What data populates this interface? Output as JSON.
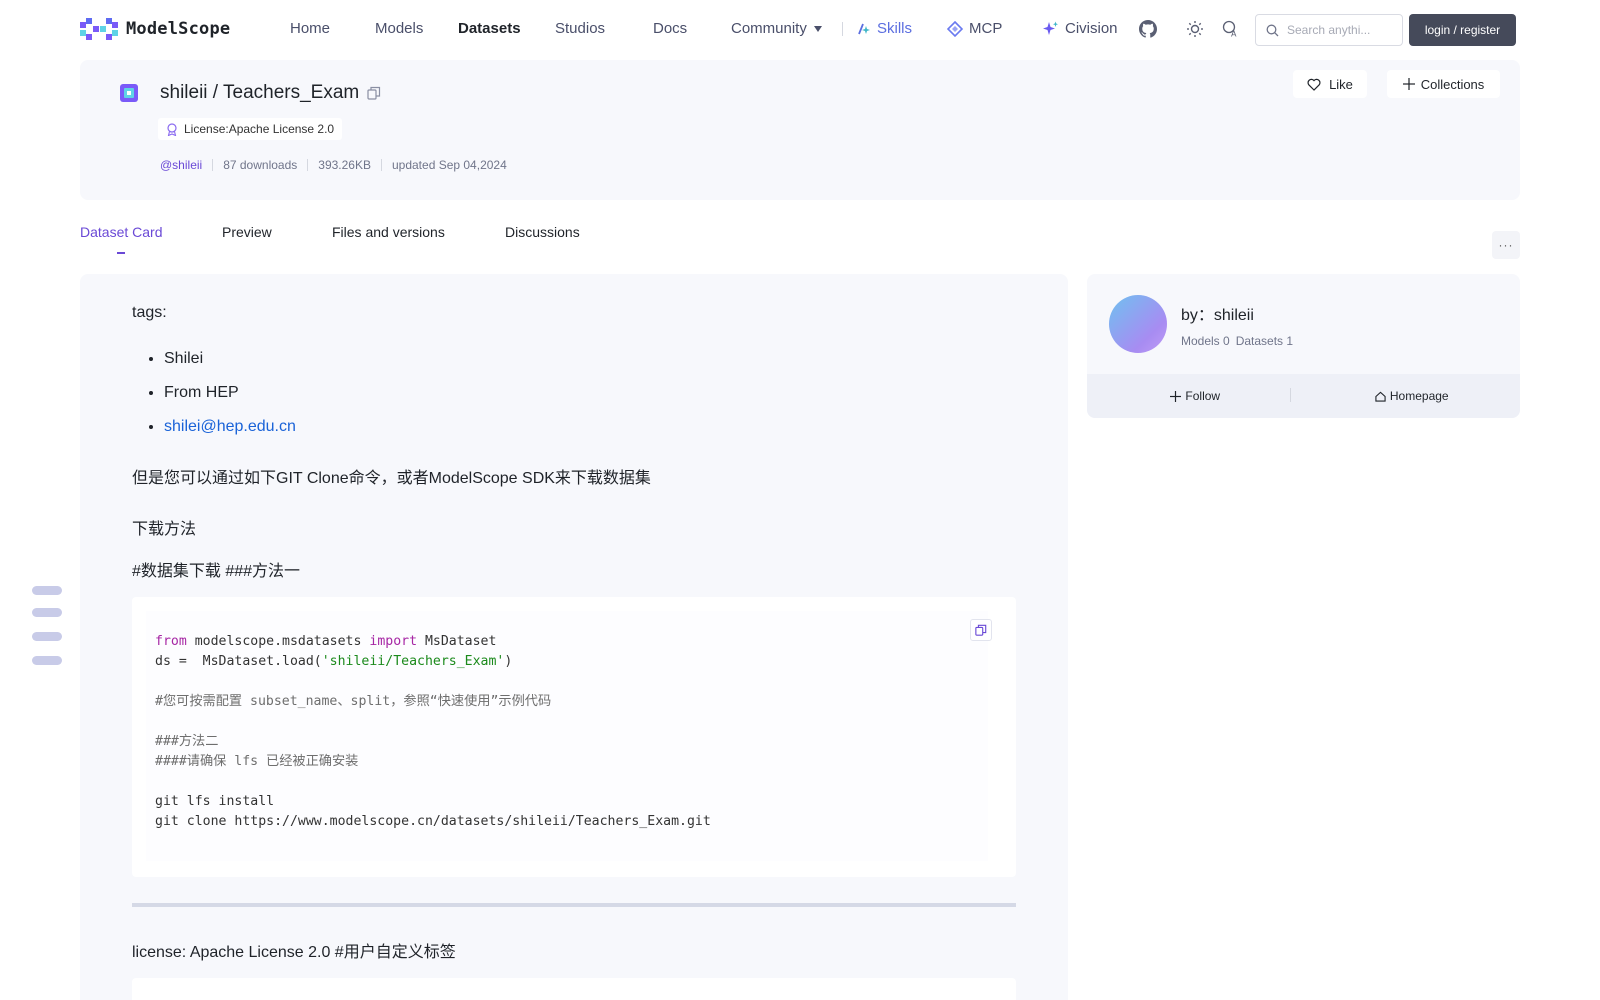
{
  "nav": {
    "brand": "ModelScope",
    "items": [
      "Home",
      "Models",
      "Datasets",
      "Studios",
      "Docs"
    ],
    "community": "Community",
    "skills": "Skills",
    "mcp": "MCP",
    "civision": "Civision",
    "search_placeholder": "Search anythi...",
    "login": "login / register",
    "accent_color": "#6a49d6"
  },
  "dataset": {
    "owner": "shileii",
    "name": "Teachers_Exam",
    "title": "shileii / Teachers_Exam",
    "license": "License:Apache License 2.0",
    "author": "@shileii",
    "downloads": "87 downloads",
    "size": "393.26KB",
    "updated": "updated Sep 04,2024",
    "like": "Like",
    "collections": "Collections"
  },
  "tabs": [
    "Dataset Card",
    "Preview",
    "Files and versions",
    "Discussions"
  ],
  "card": {
    "tags_label": "tags:",
    "tags": [
      "Shilei",
      "From HEP",
      "shilei@hep.edu.cn"
    ],
    "p1": "但是您可以通过如下GIT Clone命令，或者ModelScope SDK来下载数据集",
    "p2": "下载方法",
    "p3": "#数据集下载 ###方法一",
    "code": {
      "l1_from": "from",
      "l1_mod": " modelscope.msdatasets ",
      "l1_import": "import",
      "l1_rest": " MsDataset",
      "l2_pre": "ds =  MsDataset.load(",
      "l2_str": "'shileii/Teachers_Exam'",
      "l2_post": ")",
      "l4": "#您可按需配置 subset_name、split，参照“快速使用”示例代码",
      "l6": "###方法二",
      "l7": "####请确保 lfs 已经被正确安装",
      "l9": "git lfs install",
      "l10": "git clone https://www.modelscope.cn/datasets/shileii/Teachers_Exam.git"
    },
    "p4": "license: Apache License 2.0 #用户自定义标签"
  },
  "author_card": {
    "by": "by：shileii",
    "models": "Models 0",
    "datasets": "Datasets 1",
    "follow": "Follow",
    "homepage": "Homepage"
  }
}
